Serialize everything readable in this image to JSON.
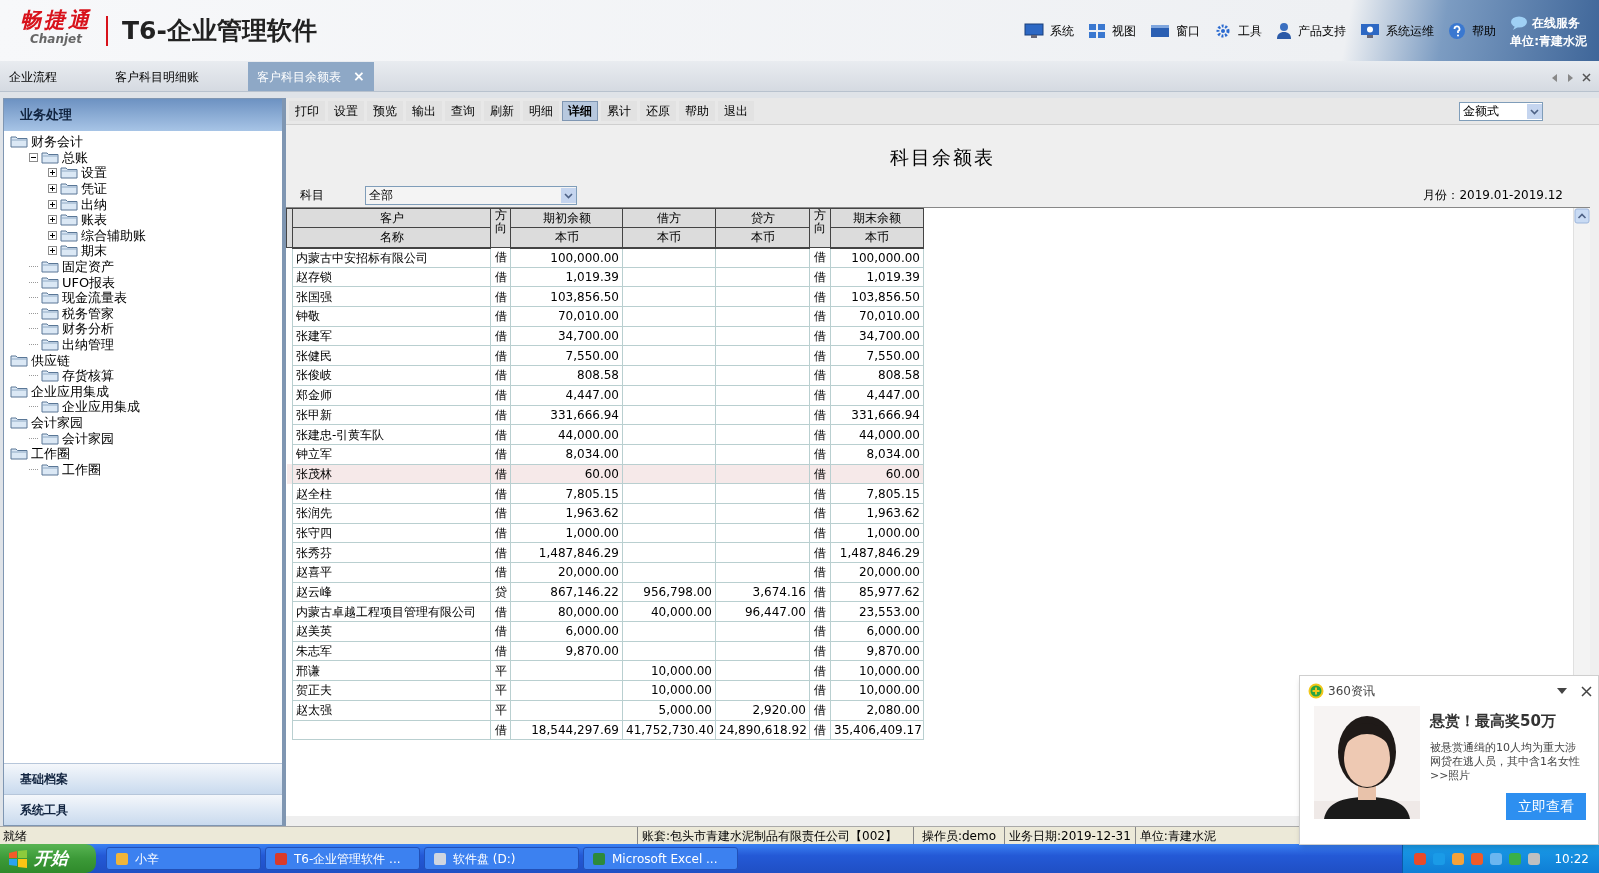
{
  "header": {
    "brand": "畅捷通",
    "brand_sub": "Chanjet",
    "product": "T6-企业管理软件",
    "menu": [
      {
        "label": "系统"
      },
      {
        "label": "视图"
      },
      {
        "label": "窗口"
      },
      {
        "label": "工具"
      },
      {
        "label": "产品支持"
      },
      {
        "label": "系统运维"
      },
      {
        "label": "帮助"
      }
    ],
    "online_service": "在线服务",
    "unit": "单位:青建水泥"
  },
  "tabs": [
    {
      "label": "企业流程",
      "selected": false
    },
    {
      "label": "客户科目明细账",
      "selected": false
    },
    {
      "label": "客户科目余额表",
      "selected": true,
      "close": "×"
    }
  ],
  "sidebar": {
    "title": "业务处理",
    "tree": [
      {
        "label": "财务会计",
        "children": [
          {
            "label": "总账",
            "expanded": true,
            "children": [
              {
                "label": "设置",
                "expanded": false
              },
              {
                "label": "凭证",
                "expanded": false
              },
              {
                "label": "出纳",
                "expanded": false
              },
              {
                "label": "账表",
                "expanded": false
              },
              {
                "label": "综合辅助账",
                "expanded": false
              },
              {
                "label": "期末",
                "expanded": false
              }
            ]
          },
          {
            "label": "固定资产"
          },
          {
            "label": "UFO报表"
          },
          {
            "label": "现金流量表"
          },
          {
            "label": "税务管家"
          },
          {
            "label": "财务分析"
          },
          {
            "label": "出纳管理"
          }
        ]
      },
      {
        "label": "供应链",
        "children": [
          {
            "label": "存货核算"
          }
        ]
      },
      {
        "label": "企业应用集成",
        "children": [
          {
            "label": "企业应用集成"
          }
        ]
      },
      {
        "label": "会计家园",
        "children": [
          {
            "label": "会计家园"
          }
        ]
      },
      {
        "label": "工作圈",
        "children": [
          {
            "label": "工作圈"
          }
        ]
      }
    ],
    "sections": [
      "基础档案",
      "系统工具"
    ]
  },
  "toolbar": {
    "buttons": [
      {
        "label": "打印",
        "selected": false
      },
      {
        "label": "设置",
        "selected": false
      },
      {
        "label": "预览",
        "selected": false
      },
      {
        "label": "输出",
        "selected": false
      },
      {
        "label": "查询",
        "selected": false
      },
      {
        "label": "刷新",
        "selected": false
      },
      {
        "label": "明细",
        "selected": false
      },
      {
        "label": "详细",
        "selected": true
      },
      {
        "label": "累计",
        "selected": false
      },
      {
        "label": "还原",
        "selected": false
      },
      {
        "label": "帮助",
        "selected": false
      },
      {
        "label": "退出",
        "selected": false
      }
    ],
    "format": "金额式"
  },
  "report": {
    "title": "科目余额表",
    "subject_label": "科目",
    "subject_value": "全部",
    "period": "月份：2019.01-2019.12",
    "columns": [
      {
        "group": "客户",
        "sub": "名称"
      },
      {
        "label": "方向"
      },
      {
        "group": "期初余额",
        "sub": "本币"
      },
      {
        "group": "借方",
        "sub": "本币"
      },
      {
        "group": "贷方",
        "sub": "本币"
      },
      {
        "label": "方向"
      },
      {
        "group": "期末余额",
        "sub": "本币"
      }
    ],
    "rows": [
      {
        "name": "内蒙古中安招标有限公司",
        "dir": "借",
        "opening": "100,000.00",
        "end_dir": "借",
        "closing": "100,000.00",
        "selected": false
      },
      {
        "name": "赵存锁",
        "dir": "借",
        "opening": "1,019.39",
        "end_dir": "借",
        "closing": "1,019.39",
        "selected": false
      },
      {
        "name": "张国强",
        "dir": "借",
        "opening": "103,856.50",
        "end_dir": "借",
        "closing": "103,856.50",
        "selected": false
      },
      {
        "name": "钟敬",
        "dir": "借",
        "opening": "70,010.00",
        "end_dir": "借",
        "closing": "70,010.00",
        "selected": false
      },
      {
        "name": "张建军",
        "dir": "借",
        "opening": "34,700.00",
        "end_dir": "借",
        "closing": "34,700.00",
        "selected": false
      },
      {
        "name": "张健民",
        "dir": "借",
        "opening": "7,550.00",
        "end_dir": "借",
        "closing": "7,550.00",
        "selected": false
      },
      {
        "name": "张俊岐",
        "dir": "借",
        "opening": "808.58",
        "end_dir": "借",
        "closing": "808.58",
        "selected": false
      },
      {
        "name": "郑金师",
        "dir": "借",
        "opening": "4,447.00",
        "end_dir": "借",
        "closing": "4,447.00",
        "selected": false
      },
      {
        "name": "张甲新",
        "dir": "借",
        "opening": "331,666.94",
        "end_dir": "借",
        "closing": "331,666.94",
        "selected": false
      },
      {
        "name": "张建忠-引黄车队",
        "dir": "借",
        "opening": "44,000.00",
        "end_dir": "借",
        "closing": "44,000.00",
        "selected": false
      },
      {
        "name": "钟立军",
        "dir": "借",
        "opening": "8,034.00",
        "end_dir": "借",
        "closing": "8,034.00",
        "selected": false
      },
      {
        "name": "张茂林",
        "dir": "借",
        "opening": "60.00",
        "end_dir": "借",
        "closing": "60.00",
        "selected": true
      },
      {
        "name": "赵全柱",
        "dir": "借",
        "opening": "7,805.15",
        "end_dir": "借",
        "closing": "7,805.15",
        "selected": false
      },
      {
        "name": "张润先",
        "dir": "借",
        "opening": "1,963.62",
        "end_dir": "借",
        "closing": "1,963.62",
        "selected": false
      },
      {
        "name": "张守四",
        "dir": "借",
        "opening": "1,000.00",
        "end_dir": "借",
        "closing": "1,000.00",
        "selected": false
      },
      {
        "name": "张秀芬",
        "dir": "借",
        "opening": "1,487,846.29",
        "end_dir": "借",
        "closing": "1,487,846.29",
        "selected": false
      },
      {
        "name": "赵喜平",
        "dir": "借",
        "opening": "20,000.00",
        "end_dir": "借",
        "closing": "20,000.00",
        "selected": false
      },
      {
        "name": "赵云峰",
        "dir": "贷",
        "opening": "867,146.22",
        "debit": "956,798.00",
        "credit": "3,674.16",
        "end_dir": "借",
        "closing": "85,977.62",
        "selected": false
      },
      {
        "name": "内蒙古卓越工程项目管理有限公司",
        "dir": "借",
        "opening": "80,000.00",
        "debit": "40,000.00",
        "credit": "96,447.00",
        "end_dir": "借",
        "closing": "23,553.00",
        "selected": false
      },
      {
        "name": "赵美英",
        "dir": "借",
        "opening": "6,000.00",
        "end_dir": "借",
        "closing": "6,000.00",
        "selected": false
      },
      {
        "name": "朱志军",
        "dir": "借",
        "opening": "9,870.00",
        "end_dir": "借",
        "closing": "9,870.00",
        "selected": false
      },
      {
        "name": "邢谦",
        "dir": "平",
        "debit": "10,000.00",
        "end_dir": "借",
        "closing": "10,000.00",
        "selected": false
      },
      {
        "name": "贺正夫",
        "dir": "平",
        "debit": "10,000.00",
        "end_dir": "借",
        "closing": "10,000.00",
        "selected": false
      },
      {
        "name": "赵太强",
        "dir": "平",
        "debit": "5,000.00",
        "credit": "2,920.00",
        "end_dir": "借",
        "closing": "2,080.00",
        "selected": false
      },
      {
        "dir": "借",
        "opening": "18,544,297.69",
        "debit": "41,752,730.40",
        "credit": "24,890,618.92",
        "end_dir": "借",
        "closing": "35,406,409.17",
        "selected": false
      }
    ]
  },
  "status_bar": {
    "state": "就绪",
    "ledger": "账套:包头市青建水泥制品有限责任公司【002】",
    "operator": "操作员:demo",
    "date": "业务日期:2019-12-31",
    "unit": "单位:青建水泥"
  },
  "taskbar": {
    "start": "开始",
    "tasks": [
      {
        "label": "小辛"
      },
      {
        "label": "T6-企业管理软件 ..."
      },
      {
        "label": "软件盘 (D:)"
      },
      {
        "label": "Microsoft Excel ..."
      }
    ],
    "clock": "10:22"
  },
  "popup": {
    "source": "360资讯",
    "headline": "悬赏！最高奖50万",
    "body": "被悬赏通缉的10人均为重大涉网贷在逃人员，其中含1名女性>>照片",
    "button": "立即查看"
  }
}
